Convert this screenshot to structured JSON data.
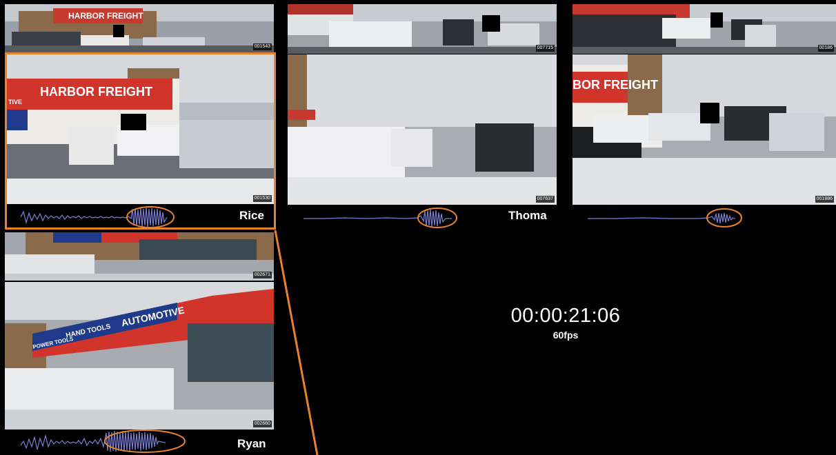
{
  "cameras": {
    "rice": {
      "label": "Rice",
      "top_frame": "001543",
      "main_frame": "001530",
      "sign_text": "HARBOR FREIGHT",
      "tag": "TIVE"
    },
    "thoma": {
      "label": "Thoma",
      "top_frame": "007715",
      "main_frame": "007637"
    },
    "third": {
      "top_frame": "00186",
      "main_frame": "001886",
      "sign_text": "BOR FREIGHT"
    },
    "ryan": {
      "label": "Ryan",
      "top_frame": "002671",
      "main_frame": "002660",
      "signs": [
        "POWER TOOLS",
        "HAND TOOLS",
        "AUTOMOTIVE"
      ]
    }
  },
  "timecode": "00:00:21:06",
  "fps": "60fps",
  "colors": {
    "highlight": "#e8832c",
    "waveform": "#7b7fd6",
    "sign_red": "#d8332a",
    "sign_blue": "#1f3a8a"
  }
}
